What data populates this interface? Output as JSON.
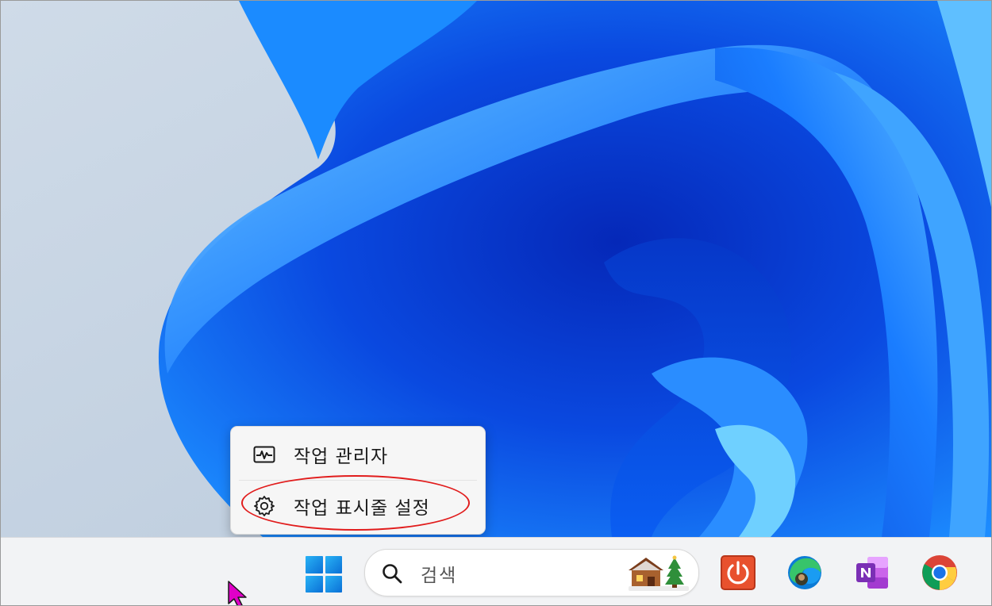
{
  "context_menu": {
    "items": [
      {
        "label": "작업 관리자",
        "icon": "task-manager-icon"
      },
      {
        "label": "작업 표시줄 설정",
        "icon": "gear-icon",
        "highlighted": true
      }
    ],
    "highlight_color": "#e11c1c"
  },
  "taskbar": {
    "start_icon": "windows-logo-icon",
    "search": {
      "placeholder": "검색",
      "icon": "search-icon"
    },
    "apps": [
      {
        "name": "power-app-icon",
        "color": "#e8512e"
      },
      {
        "name": "edge-icon",
        "color": "#0c7bd6"
      },
      {
        "name": "onenote-icon",
        "color": "#7b2fb5"
      },
      {
        "name": "chrome-icon",
        "color": "#db4437"
      }
    ]
  },
  "wallpaper": {
    "name": "windows-11-bloom",
    "accent": "#0a5cf0"
  }
}
